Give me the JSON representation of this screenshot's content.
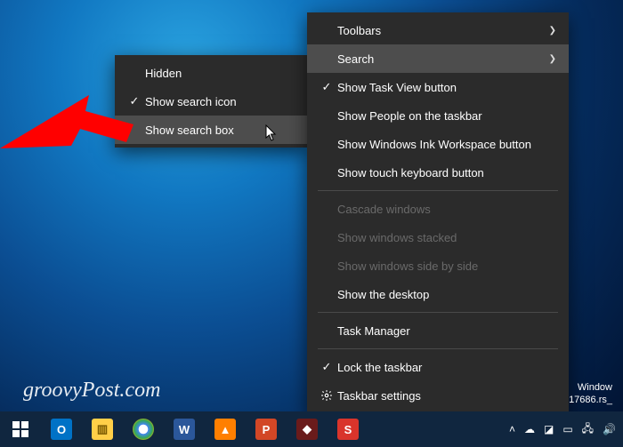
{
  "submenu": {
    "items": [
      {
        "label": "Hidden",
        "checked": false
      },
      {
        "label": "Show search icon",
        "checked": true
      },
      {
        "label": "Show search box",
        "checked": false,
        "hover": true
      }
    ]
  },
  "menu": {
    "items": [
      {
        "label": "Toolbars",
        "submenu": true
      },
      {
        "label": "Search",
        "submenu": true,
        "hover": true
      },
      {
        "label": "Show Task View button",
        "checked": true
      },
      {
        "label": "Show People on the taskbar"
      },
      {
        "label": "Show Windows Ink Workspace button"
      },
      {
        "label": "Show touch keyboard button"
      },
      {
        "sep": true
      },
      {
        "label": "Cascade windows",
        "disabled": true
      },
      {
        "label": "Show windows stacked",
        "disabled": true
      },
      {
        "label": "Show windows side by side",
        "disabled": true
      },
      {
        "label": "Show the desktop"
      },
      {
        "sep": true
      },
      {
        "label": "Task Manager"
      },
      {
        "sep": true
      },
      {
        "label": "Lock the taskbar",
        "checked": true
      },
      {
        "label": "Taskbar settings",
        "icon": "gear"
      }
    ]
  },
  "watermark": "groovyPost.com",
  "build": {
    "line1": "Window",
    "line2": "17686.rs_"
  },
  "taskbar": {
    "apps": [
      {
        "name": "outlook",
        "bg": "#0072c6",
        "glyph": "O"
      },
      {
        "name": "file-explorer",
        "bg": "#ffcf48",
        "glyph": "📁"
      },
      {
        "name": "chrome",
        "bg": "#ffffff",
        "glyph": "◉"
      },
      {
        "name": "word",
        "bg": "#2b579a",
        "glyph": "W"
      },
      {
        "name": "vlc",
        "bg": "#ff7f00",
        "glyph": "▲"
      },
      {
        "name": "powerpoint",
        "bg": "#d24726",
        "glyph": "P"
      },
      {
        "name": "threatfire",
        "bg": "#6a1b1b",
        "glyph": "◆"
      },
      {
        "name": "snagit",
        "bg": "#d9342b",
        "glyph": "S"
      }
    ]
  }
}
